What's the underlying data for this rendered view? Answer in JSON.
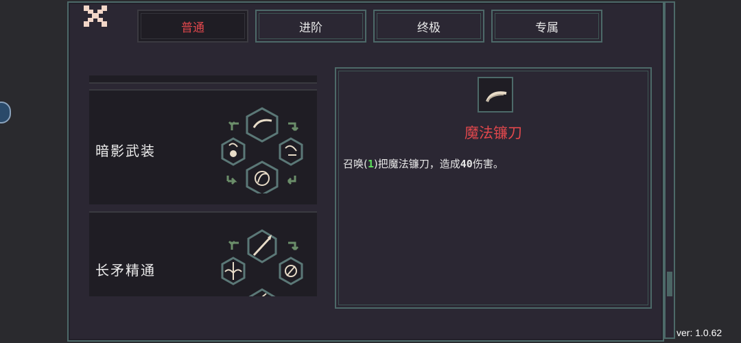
{
  "tabs": [
    {
      "label": "普通",
      "active": true
    },
    {
      "label": "进阶",
      "active": false
    },
    {
      "label": "终极",
      "active": false
    },
    {
      "label": "专属",
      "active": false
    }
  ],
  "skill_list": [
    {
      "name": "暗影武装"
    },
    {
      "name": "长矛精通"
    }
  ],
  "detail": {
    "icon": "scythe-icon",
    "title": "魔法镰刀",
    "desc_prefix": "召唤(",
    "desc_count": "1",
    "desc_middle": ")把魔法镰刀，造成",
    "desc_damage": "40",
    "desc_suffix": "伤害。"
  },
  "version": "ver: 1.0.62",
  "colors": {
    "accent_red": "#e0474c",
    "highlight_green": "#5de05d",
    "frame": "#4d6a69",
    "panel": "#2b2733"
  }
}
